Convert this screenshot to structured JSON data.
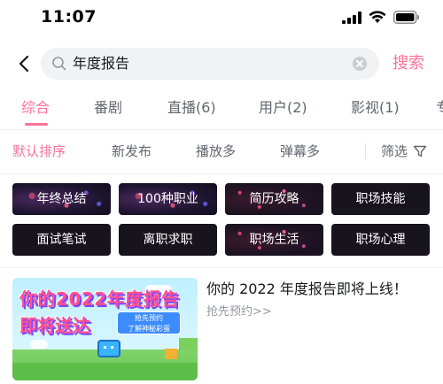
{
  "status_bar": {
    "time": "11:07",
    "icons": [
      "signal-icon",
      "wifi-icon",
      "battery-icon"
    ]
  },
  "search": {
    "query": "年度报告",
    "submit_label": "搜索"
  },
  "tabs": [
    {
      "label": "综合",
      "active": true
    },
    {
      "label": "番剧",
      "active": false
    },
    {
      "label": "直播(6)",
      "active": false
    },
    {
      "label": "用户(2)",
      "active": false
    },
    {
      "label": "影视(1)",
      "active": false
    },
    {
      "label": "专",
      "active": false
    }
  ],
  "sort": {
    "options": [
      {
        "label": "默认排序",
        "active": true
      },
      {
        "label": "新发布",
        "active": false
      },
      {
        "label": "播放多",
        "active": false
      },
      {
        "label": "弹幕多",
        "active": false
      }
    ],
    "filter_label": "筛选"
  },
  "tags": [
    "年终总结",
    "100种职业",
    "简历攻略",
    "职场技能",
    "面试笔试",
    "离职求职",
    "职场生活",
    "职场心理"
  ],
  "result": {
    "thumbnail": {
      "line1": "你的2022年度报告",
      "line2": "即将送达",
      "badge_line1": "抢先预约",
      "badge_line2": "了解神秘彩蛋"
    },
    "title": "你的 2022 年度报告即将上线！",
    "subtitle": "抢先预约>>"
  },
  "colors": {
    "accent": "#fb7299",
    "text_secondary": "#61666d",
    "muted": "#9499a0"
  }
}
